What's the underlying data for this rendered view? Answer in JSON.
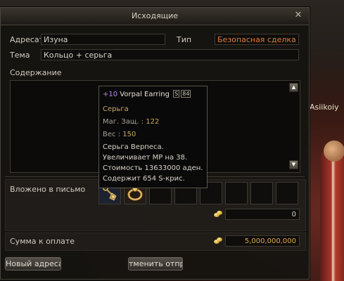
{
  "window": {
    "title": "Исходящие"
  },
  "form": {
    "recipient_label": "Адресат",
    "recipient_value": "Изуна",
    "type_label": "Тип",
    "type_value": "Безопасная сделка",
    "subject_label": "Тема",
    "subject_value": "Кольцо + серьга",
    "content_label": "Содержание"
  },
  "tooltip": {
    "enchant": "+10",
    "item_name": "Vorpal Earring",
    "grade_badge": "S",
    "grade_level": "84",
    "item_type": "Серьга",
    "stat_label": "Маг. Защ. : ",
    "stat_value": "122",
    "weight_label": "Вес : ",
    "weight_value": "150",
    "description": [
      "Серьга Верпеса.",
      "Увеличивает MP на 38.",
      "Стоимость 13633000 аден.",
      "Содержит 654 S-крис."
    ]
  },
  "attachments": {
    "label": "Вложено в письмо",
    "items": [
      {
        "name": "Vorpal Earring",
        "icon": "earring-icon"
      },
      {
        "name": "ring",
        "icon": "ring-icon"
      }
    ],
    "empty_slots": 6,
    "adena_value": "0"
  },
  "payment": {
    "label": "Сумма к оплате",
    "value": "5,000,000,000",
    "value_color": "#e2a84a"
  },
  "buttons": {
    "new_recipient": "Новый адресат",
    "cancel_send": "тменить отправ"
  },
  "background": {
    "name_label": "Asiikoiy"
  },
  "colors": {
    "deal_type": "#e07a3a",
    "enchant": "#b88ae8",
    "stat_value": "#c9a76a"
  }
}
